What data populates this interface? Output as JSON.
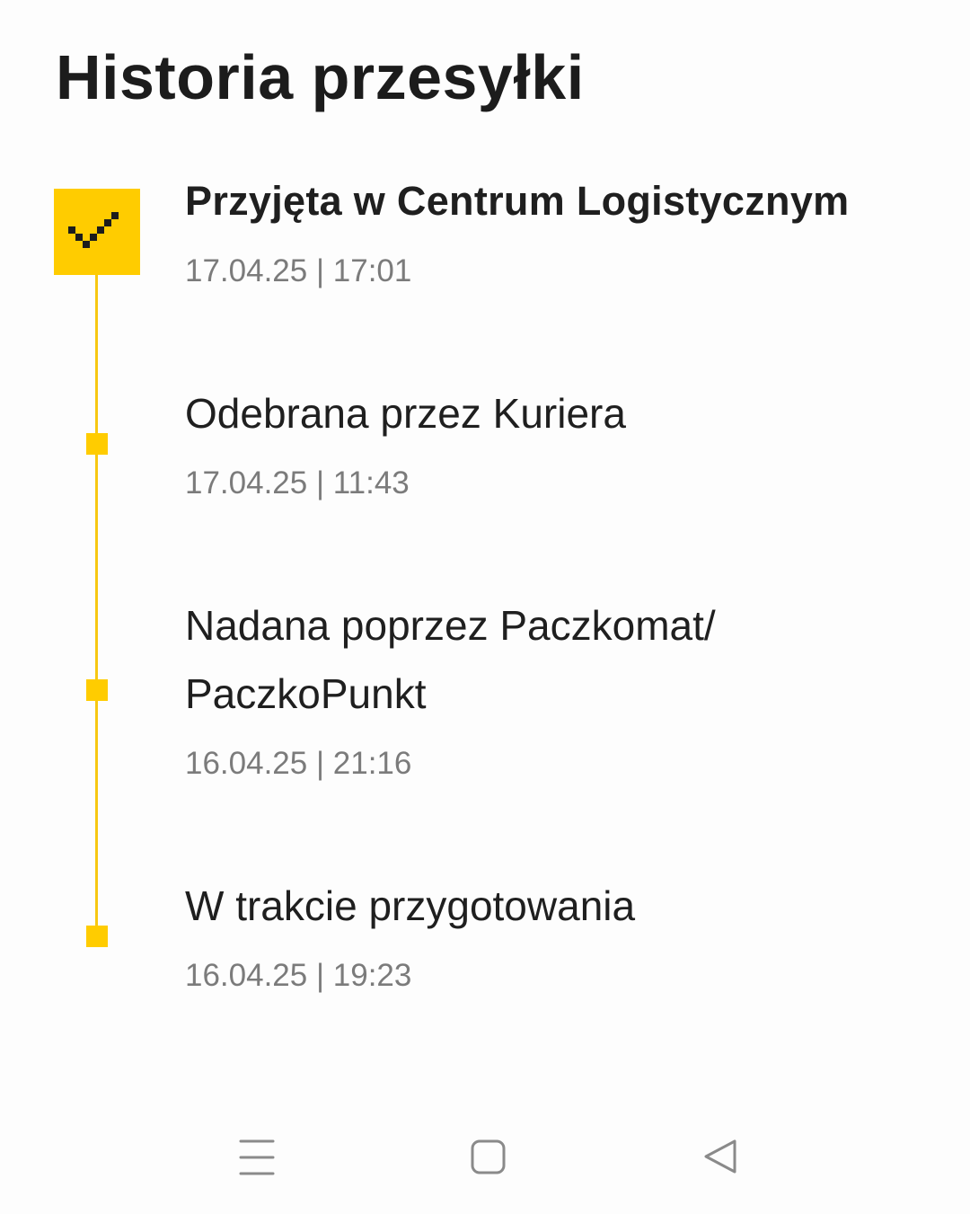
{
  "header": {
    "title": "Historia przesyłki"
  },
  "timeline": {
    "accent_color": "#ffcc00",
    "events": [
      {
        "title": "Przyjęta w Centrum Logistycznym",
        "time": "17.04.25 | 17:01",
        "current": true,
        "icon": "check-icon"
      },
      {
        "title": "Odebrana przez Kuriera",
        "time": "17.04.25 | 11:43",
        "current": false
      },
      {
        "title": "Nadana poprzez Paczkomat/ PaczkoPunkt",
        "time": "16.04.25 | 21:16",
        "current": false
      },
      {
        "title": "W trakcie przygotowania",
        "time": "16.04.25 | 19:23",
        "current": false
      }
    ]
  },
  "navigation_bar": {
    "buttons": [
      "menu-icon",
      "home-icon",
      "back-icon"
    ]
  }
}
